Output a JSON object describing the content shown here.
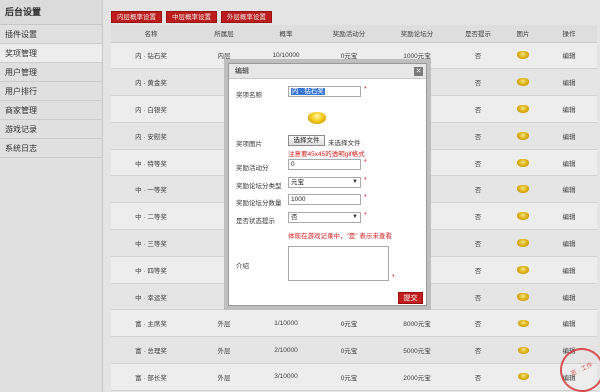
{
  "sidebar": {
    "title": "后台设置",
    "items": [
      {
        "label": "插件设置",
        "active": false
      },
      {
        "label": "奖项管理",
        "active": true
      },
      {
        "label": "用户管理",
        "active": false
      },
      {
        "label": "用户排行",
        "active": false
      },
      {
        "label": "商家管理",
        "active": false
      },
      {
        "label": "游戏记录",
        "active": false
      },
      {
        "label": "系统日志",
        "active": false
      }
    ]
  },
  "toolbar": {
    "btn_inner": "内层概率设置",
    "btn_middle": "中层概率设置",
    "btn_outer": "外层概率设置"
  },
  "table": {
    "headers": [
      "名称",
      "所属层",
      "概率",
      "奖励活动分",
      "奖励论坛分",
      "是否提示",
      "图片",
      "操作"
    ],
    "rows": [
      {
        "name": "内 · 钻石奖",
        "layer": "内层",
        "prob": "10/10000",
        "act": "0元宝",
        "forum": "1000元宝",
        "notify": "否",
        "action": "编辑"
      },
      {
        "name": "内 · 黄金奖",
        "layer": "",
        "prob": "",
        "act": "",
        "forum": "",
        "notify": "否",
        "action": "编辑"
      },
      {
        "name": "内 · 白银奖",
        "layer": "",
        "prob": "",
        "act": "",
        "forum": "",
        "notify": "否",
        "action": "编辑"
      },
      {
        "name": "内 · 安慰奖",
        "layer": "",
        "prob": "",
        "act": "",
        "forum": "",
        "notify": "否",
        "action": "编辑"
      },
      {
        "name": "中 · 特等奖",
        "layer": "",
        "prob": "",
        "act": "",
        "forum": "",
        "notify": "否",
        "action": "编辑"
      },
      {
        "name": "中 · 一等奖",
        "layer": "",
        "prob": "",
        "act": "",
        "forum": "",
        "notify": "否",
        "action": "编辑"
      },
      {
        "name": "中 · 二等奖",
        "layer": "",
        "prob": "",
        "act": "",
        "forum": "",
        "notify": "否",
        "action": "编辑"
      },
      {
        "name": "中 · 三等奖",
        "layer": "",
        "prob": "",
        "act": "",
        "forum": "",
        "notify": "否",
        "action": "编辑"
      },
      {
        "name": "中 · 四等奖",
        "layer": "",
        "prob": "",
        "act": "",
        "forum": "",
        "notify": "否",
        "action": "编辑"
      },
      {
        "name": "中 · 幸运奖",
        "layer": "",
        "prob": "",
        "act": "",
        "forum": "",
        "notify": "否",
        "action": "编辑"
      },
      {
        "name": "富 · 主席奖",
        "layer": "外层",
        "prob": "1/10000",
        "act": "0元宝",
        "forum": "8000元宝",
        "notify": "否",
        "action": "编辑"
      },
      {
        "name": "富 · 总理奖",
        "layer": "外层",
        "prob": "2/10000",
        "act": "0元宝",
        "forum": "5000元宝",
        "notify": "否",
        "action": "编辑"
      },
      {
        "name": "富 · 部长奖",
        "layer": "外层",
        "prob": "3/10000",
        "act": "0元宝",
        "forum": "2000元宝",
        "notify": "否",
        "action": "编辑"
      }
    ]
  },
  "dialog": {
    "title": "编辑",
    "close": "✕",
    "name_label": "奖项名称",
    "name_value": "内 · 钻石奖",
    "image_label": "奖项图片",
    "file_button": "选择文件",
    "file_status": "未选择文件",
    "image_hint": "注意要45x45的透明gif格式",
    "act_label": "奖励活动分",
    "act_value": "0",
    "forum_type_label": "奖励论坛分类型",
    "forum_type_value": "元宝",
    "forum_amount_label": "奖励论坛分数量",
    "forum_amount_value": "1000",
    "notify_label": "是否状态提示",
    "notify_value": "否",
    "notify_hint": "体现在游戏记录中，\"是\" 表示未查看",
    "intro_label": "介绍",
    "submit": "提交",
    "required_mark": "*"
  },
  "stamp": {
    "text": "苦 · 工作"
  }
}
